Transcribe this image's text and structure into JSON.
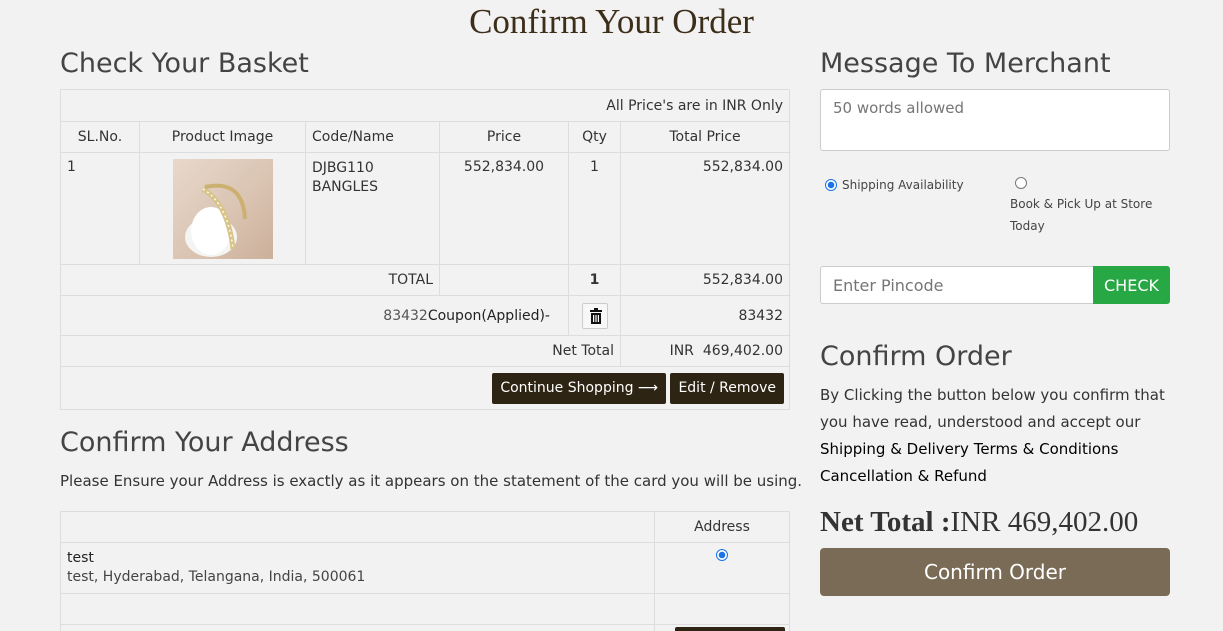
{
  "page_title": "Confirm Your Order",
  "basket": {
    "heading": "Check Your Basket",
    "price_note": "All Price's are in INR Only",
    "columns": [
      "SL.No.",
      "Product Image",
      "Code/Name",
      "Price",
      "Qty",
      "Total Price"
    ],
    "items": [
      {
        "sl": "1",
        "code": "DJBG110",
        "name": "BANGLES",
        "price": "552,834.00",
        "qty": "1",
        "total": "552,834.00",
        "image_icon": "bangle-product-photo"
      }
    ],
    "total_label": "TOTAL",
    "total_qty": "1",
    "total_amount": "552,834.00",
    "coupon_code": "83432",
    "coupon_label": "Coupon(Applied)-",
    "coupon_amount": "83432",
    "net_label": "Net Total",
    "net_currency": "INR",
    "net_amount": "469,402.00",
    "continue_label": "Continue Shopping ⟶",
    "edit_label": "Edit / Remove"
  },
  "address": {
    "heading": "Confirm Your Address",
    "note": "Please Ensure your Address is exactly as it appears on the statement of the card you will be using.",
    "column": "Address",
    "entries": [
      {
        "name": "test",
        "line": "test, Hyderabad, Telangana, India, 500061",
        "selected": true
      }
    ]
  },
  "merchant": {
    "heading": "Message To Merchant",
    "placeholder": "50 words allowed",
    "option_shipping": "Shipping Availability",
    "option_pickup": "Book & Pick Up at Store Today",
    "pincode_placeholder": "Enter Pincode",
    "check_label": "CHECK"
  },
  "confirm": {
    "heading": "Confirm Order",
    "text_plain": "By Clicking the button below you confirm that you have read, understood and accept our",
    "text_links": "Shipping & Delivery Terms & Conditions Cancellation & Refund",
    "net_label": "Net Total :",
    "net_value": "INR 469,402.00",
    "button_label": "Confirm Order"
  },
  "colors": {
    "brand_dark": "#2e2413",
    "confirm_button": "#7a6b57",
    "check_button": "#28a745"
  }
}
